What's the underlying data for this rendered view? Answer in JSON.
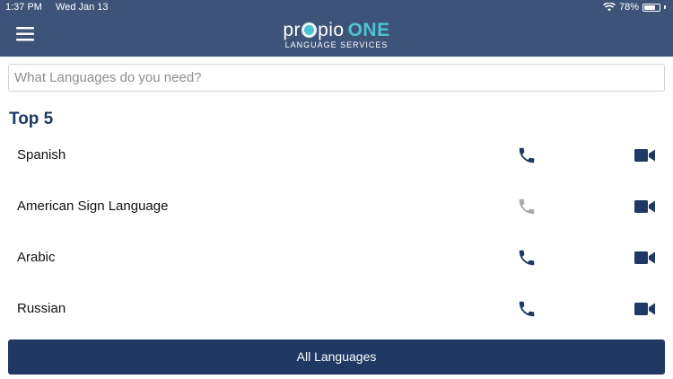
{
  "status_bar": {
    "time": "1:37 PM",
    "date": "Wed Jan 13",
    "battery": "78%",
    "battery_level": 0.78
  },
  "header": {
    "logo_prefix": "pr",
    "logo_suffix": "pio",
    "logo_one": "ONE",
    "logo_subtitle": "LANGUAGE SERVICES",
    "menu_icon": "hamburger-menu-icon",
    "color": "#3d5478",
    "accent": "#4fc3cf"
  },
  "search": {
    "value": "",
    "placeholder": "What Languages do you need?"
  },
  "top_section": {
    "title": "Top 5",
    "languages": [
      {
        "name": "Spanish",
        "phone_enabled": true,
        "video_enabled": true
      },
      {
        "name": "American Sign Language",
        "phone_enabled": false,
        "video_enabled": true
      },
      {
        "name": "Arabic",
        "phone_enabled": true,
        "video_enabled": true
      },
      {
        "name": "Russian",
        "phone_enabled": true,
        "video_enabled": true
      }
    ],
    "icons": {
      "phone": "phone-icon",
      "video": "video-camera-icon"
    },
    "enabled_color": "#1f3864",
    "disabled_color": "#a9a9a9"
  },
  "footer": {
    "all_languages_label": "All Languages",
    "color": "#1f3864"
  }
}
